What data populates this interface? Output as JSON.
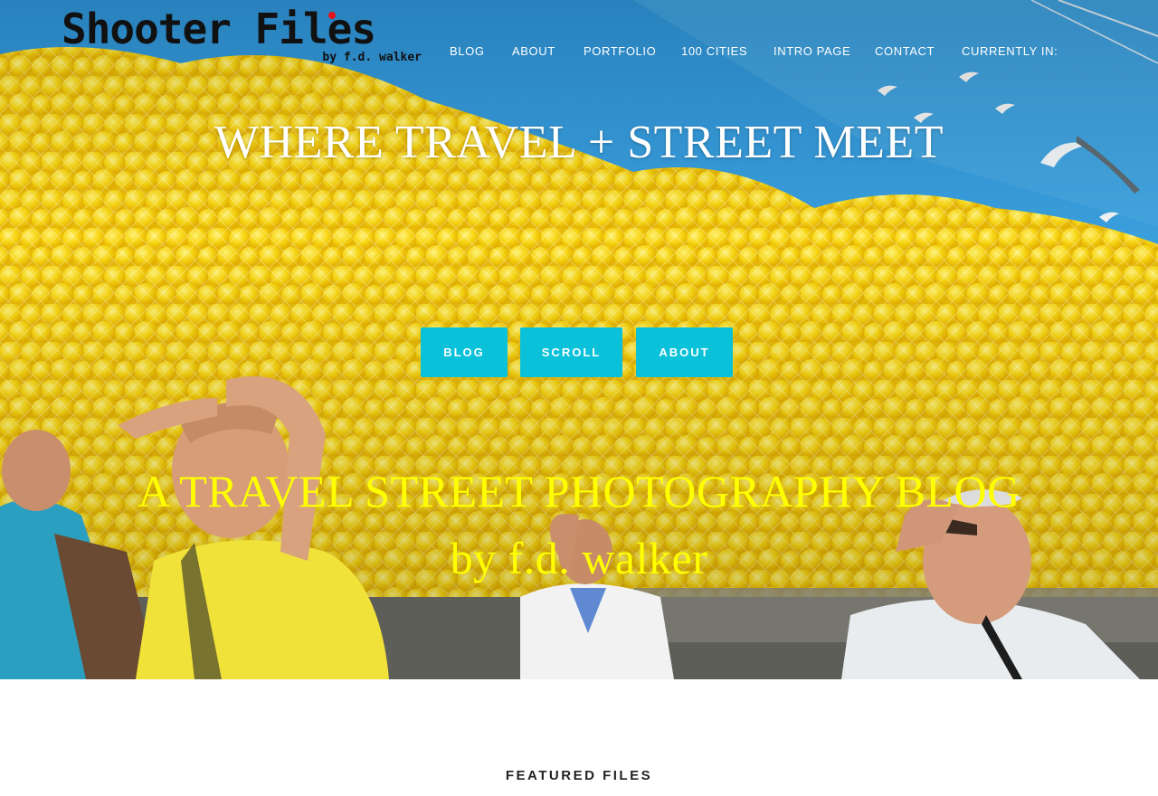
{
  "logo": {
    "title": "Shooter Files",
    "subtitle": "by f.d. walker"
  },
  "nav": {
    "items": [
      {
        "label": "BLOG"
      },
      {
        "label": "ABOUT"
      },
      {
        "label": "PORTFOLIO"
      },
      {
        "label": "100 CITIES"
      },
      {
        "label": "INTRO PAGE"
      },
      {
        "label": "CONTACT"
      },
      {
        "label": "CURRENTLY IN:"
      }
    ]
  },
  "hero": {
    "headline": "WHERE TRAVEL + STREET MEET",
    "buttons": [
      {
        "label": "BLOG"
      },
      {
        "label": "SCROLL"
      },
      {
        "label": "ABOUT"
      }
    ],
    "tagline_line1": "A TRAVEL STREET PHOTOGRAPHY BLOG",
    "tagline_line2": "by f.d. walker"
  },
  "featured": {
    "heading": "FEATURED FILES"
  },
  "colors": {
    "button": "#09c1d8",
    "tagline": "#ffff00",
    "logo_dot": "#e3151a",
    "sky": "#2d8fd0",
    "balloon": "#f6d10e"
  },
  "icons": {
    "hero_photo": "balloon-crowd-photo"
  }
}
